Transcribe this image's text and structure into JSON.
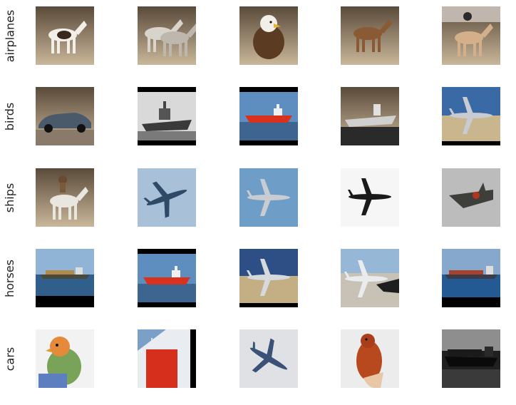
{
  "rows": [
    {
      "label": "airplanes",
      "images": [
        "horse-pinto",
        "horse-carriage",
        "eagle",
        "horse-brown",
        "horse-rodeo"
      ]
    },
    {
      "label": "birds",
      "images": [
        "car-sedan",
        "ship-warship-bw",
        "ship-tanker-red",
        "ship-warship-gray",
        "airplane-jet-parked"
      ]
    },
    {
      "label": "ships",
      "images": [
        "horse-rider",
        "airplane-bomber-sky",
        "airplane-fighter-sky",
        "airplane-silhouette-white",
        "airplane-delta-gray"
      ]
    },
    {
      "label": "horses",
      "images": [
        "ship-cargo-sea",
        "ship-tanker-red",
        "airplane-jet-tarmac",
        "airplane-jet-ground",
        "ship-cargo-sea-2"
      ]
    },
    {
      "label": "cars",
      "images": [
        "bird-lovebird",
        "ship-red-hull",
        "airplane-fighter-blue",
        "bird-robin",
        "ship-cargo-dark"
      ]
    }
  ]
}
